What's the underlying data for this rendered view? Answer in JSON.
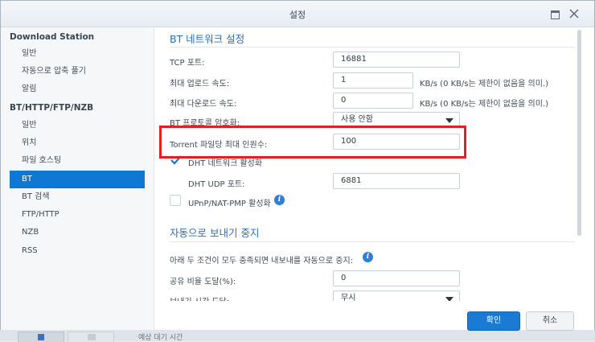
{
  "window": {
    "title": "설정"
  },
  "sidebar": {
    "groups": [
      {
        "label": "Download Station",
        "items": [
          "일반",
          "자동으로 압축 풀기",
          "알림"
        ]
      },
      {
        "label": "BT/HTTP/FTP/NZB",
        "items": [
          "일반",
          "위치",
          "파일 호스팅",
          "BT",
          "BT 검색",
          "FTP/HTTP",
          "NZB",
          "RSS"
        ]
      }
    ],
    "active": "BT"
  },
  "bt_settings": {
    "title": "BT 네트워크 설정",
    "tcp_port": {
      "label": "TCP 포트:",
      "value": "16881"
    },
    "max_upload": {
      "label": "최대 업로드 속도:",
      "value": "1",
      "suffix": "KB/s (0 KB/s는 제한이 없음을 의미.)"
    },
    "max_download": {
      "label": "최대 다운로드 속도:",
      "value": "0",
      "suffix": "KB/s (0 KB/s는 제한이 없음을 의미.)"
    },
    "encryption": {
      "label": "BT 프로토콜 암호화:",
      "value": "사용 안함"
    },
    "max_peers": {
      "label": "Torrent 파일당 최대 인원수:",
      "value": "100"
    },
    "dht": {
      "label": "DHT 네트워크 활성화",
      "checked": true
    },
    "dht_port": {
      "label": "DHT UDP 포트:",
      "value": "6881"
    },
    "upnp": {
      "label": "UPnP/NAT-PMP 활성화",
      "checked": false
    }
  },
  "auto_stop": {
    "title": "자동으로 보내기 중지",
    "description": "아래 두 조건이 모두 충족되면 내보내를 자동으로 중지:",
    "share_ratio": {
      "label": "공유 비율 도달(%):",
      "value": "0"
    },
    "seed_time": {
      "label": "보내기 시간 도달:",
      "value": "무시"
    }
  },
  "footer": {
    "ok_label": "확인",
    "cancel_label": "취소"
  },
  "background": {
    "text": "예상 대기 시간"
  },
  "colors": {
    "accent": "#0f78d2",
    "highlight": "#e51d25",
    "section_title": "#2b6fb9"
  }
}
